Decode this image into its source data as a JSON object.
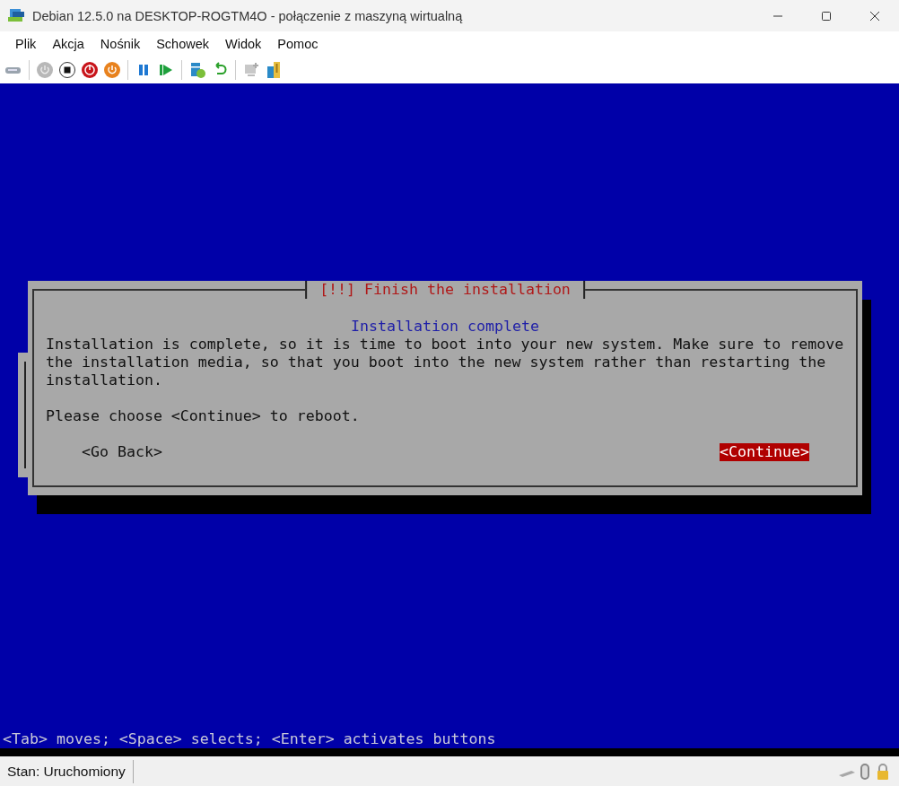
{
  "window": {
    "title": "Debian 12.5.0 na DESKTOP-ROGTM4O - połączenie z maszyną wirtualną"
  },
  "menu": [
    "Plik",
    "Akcja",
    "Nośnik",
    "Schowek",
    "Widok",
    "Pomoc"
  ],
  "console": {
    "dialog": {
      "title": "[!!] Finish the installation",
      "heading": "Installation complete",
      "paragraphs": [
        "Installation is complete, so it is time to boot into your new system. Make sure to remove the installation media, so that you boot into the new system rather than restarting the installation.",
        "Please choose <Continue> to reboot."
      ],
      "buttons": [
        {
          "label": "<Go Back>",
          "selected": false
        },
        {
          "label": "<Continue>",
          "selected": true
        }
      ]
    },
    "hint": "<Tab> moves; <Space> selects; <Enter> activates buttons"
  },
  "status_bar": {
    "text": "Stan: Uruchomiony"
  }
}
